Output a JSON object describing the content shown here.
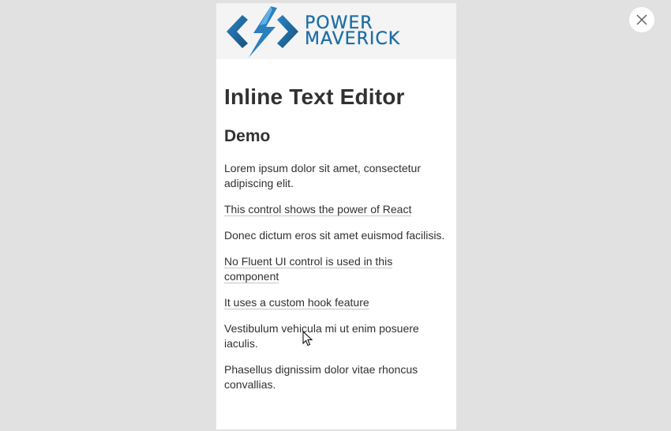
{
  "logo": {
    "line1": "POWER",
    "line2": "MAVERICK",
    "brand_color": "#1e6fa6"
  },
  "heading": "Inline Text Editor",
  "subheading": "Demo",
  "paragraphs": [
    {
      "text": "Lorem ipsum dolor sit amet, consectetur adipiscing elit.",
      "editable": false
    },
    {
      "text": "This control shows the power of React",
      "editable": true
    },
    {
      "text": "Donec dictum eros sit amet euismod facilisis.",
      "editable": false
    },
    {
      "text": "No Fluent UI control is used in this component",
      "editable": true
    },
    {
      "text": "It uses a custom hook feature",
      "editable": true
    },
    {
      "text": "Vestibulum vehicula mi ut enim posuere iaculis.",
      "editable": false
    },
    {
      "text": "Phasellus dignissim dolor vitae rhoncus convallias.",
      "editable": false
    }
  ],
  "close_icon": "close-icon",
  "colors": {
    "overlay": "#e1e1e1",
    "panel": "#ffffff",
    "text": "#323130"
  }
}
